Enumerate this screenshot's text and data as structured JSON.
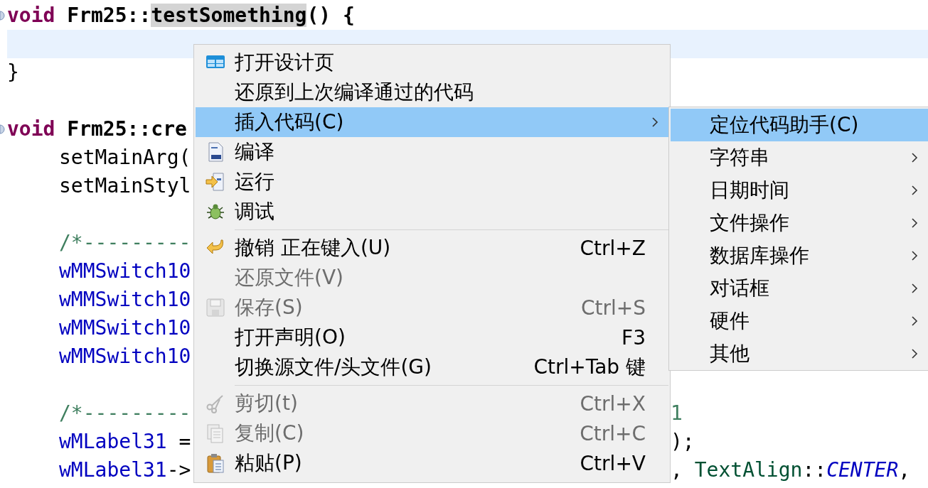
{
  "editor": {
    "lines": [
      {
        "kind": "code",
        "foldable": true,
        "current": false,
        "segments": [
          {
            "kind": "keyword",
            "text": "void",
            "highlighted": false
          },
          {
            "kind": "bold",
            "text": " Frm25::",
            "highlighted": false
          },
          {
            "kind": "bold",
            "text": "testSomething",
            "highlighted": true
          },
          {
            "kind": "bold",
            "text": "() {",
            "highlighted": false
          }
        ],
        "children": [
          {
            "kind": "blank",
            "current": true
          }
        ]
      },
      {
        "kind": "code",
        "foldable": false,
        "current": false,
        "segments": [
          {
            "kind": "plain",
            "text": "}",
            "highlighted": false
          }
        ]
      },
      {
        "kind": "blank",
        "current": false
      },
      {
        "kind": "code",
        "foldable": true,
        "current": false,
        "segments": [
          {
            "kind": "keyword",
            "text": "void",
            "highlighted": false
          },
          {
            "kind": "bold",
            "text": " Frm25::cre",
            "highlighted": false
          }
        ],
        "children": [
          {
            "kind": "code",
            "foldable": false,
            "current": false,
            "segments": [
              {
                "kind": "plain",
                "text": "setMainArg(",
                "highlighted": false
              }
            ]
          },
          {
            "kind": "code",
            "foldable": false,
            "current": false,
            "segments": [
              {
                "kind": "plain",
                "text": "setMainStyl",
                "highlighted": false
              }
            ]
          },
          {
            "kind": "blank",
            "current": false
          },
          {
            "kind": "code",
            "foldable": false,
            "current": false,
            "segments": [
              {
                "kind": "comment",
                "text": "/*---------",
                "highlighted": false
              }
            ]
          },
          {
            "kind": "code",
            "foldable": false,
            "current": false,
            "segments": [
              {
                "kind": "field",
                "text": "wMMSwitch10",
                "highlighted": false
              }
            ]
          },
          {
            "kind": "code",
            "foldable": false,
            "current": false,
            "segments": [
              {
                "kind": "field",
                "text": "wMMSwitch10",
                "highlighted": false
              }
            ]
          },
          {
            "kind": "code",
            "foldable": false,
            "current": false,
            "segments": [
              {
                "kind": "field",
                "text": "wMMSwitch10",
                "highlighted": false
              }
            ]
          },
          {
            "kind": "code",
            "foldable": false,
            "current": false,
            "segments": [
              {
                "kind": "field",
                "text": "wMMSwitch10",
                "highlighted": false
              }
            ]
          },
          {
            "kind": "blank",
            "current": false
          },
          {
            "kind": "code",
            "foldable": false,
            "current": false,
            "segments": [
              {
                "kind": "comment",
                "text": "/*---------",
                "highlighted": false
              }
            ],
            "after_menu": [
              {
                "kind": "comment",
                "text": "1",
                "highlighted": false
              }
            ]
          },
          {
            "kind": "code",
            "foldable": false,
            "current": false,
            "segments": [
              {
                "kind": "field",
                "text": "wMLabel31",
                "highlighted": false
              },
              {
                "kind": "plain",
                "text": " =",
                "highlighted": false
              }
            ],
            "after_menu": [
              {
                "kind": "plain",
                "text": ");",
                "highlighted": false
              }
            ]
          },
          {
            "kind": "code",
            "foldable": false,
            "current": false,
            "segments": [
              {
                "kind": "field",
                "text": "wMLabel31",
                "highlighted": false
              },
              {
                "kind": "plain",
                "text": "->",
                "highlighted": false
              }
            ],
            "after_menu": [
              {
                "kind": "plain",
                "text": ", ",
                "highlighted": false
              },
              {
                "kind": "type",
                "text": "TextAlign",
                "highlighted": false
              },
              {
                "kind": "plain",
                "text": "::",
                "highlighted": false
              },
              {
                "kind": "enum",
                "text": "CENTER",
                "highlighted": false
              },
              {
                "kind": "plain",
                "text": ",",
                "highlighted": false
              }
            ]
          }
        ]
      }
    ]
  },
  "menu": {
    "items": [
      {
        "kind": "item",
        "label": "打开设计页",
        "selected": false,
        "disabled": false,
        "has_submenu": false
      },
      {
        "kind": "item",
        "label": "还原到上次编译通过的代码",
        "selected": false,
        "disabled": false,
        "has_submenu": false
      },
      {
        "kind": "item",
        "label": "插入代码(C)",
        "selected": true,
        "disabled": false,
        "has_submenu": true
      },
      {
        "kind": "item",
        "label": "编译",
        "selected": false,
        "disabled": false,
        "has_submenu": false
      },
      {
        "kind": "item",
        "label": "运行",
        "selected": false,
        "disabled": false,
        "has_submenu": false
      },
      {
        "kind": "item",
        "label": "调试",
        "selected": false,
        "disabled": false,
        "has_submenu": false
      },
      {
        "kind": "separator"
      },
      {
        "kind": "item",
        "label": "撤销 正在键入(U)",
        "shortcut": "Ctrl+Z",
        "selected": false,
        "disabled": false,
        "has_submenu": false
      },
      {
        "kind": "item",
        "label": "还原文件(V)",
        "selected": false,
        "disabled": true,
        "has_submenu": false
      },
      {
        "kind": "item",
        "label": "保存(S)",
        "shortcut": "Ctrl+S",
        "selected": false,
        "disabled": true,
        "has_submenu": false
      },
      {
        "kind": "item",
        "label": "打开声明(O)",
        "shortcut": "F3",
        "selected": false,
        "disabled": false,
        "has_submenu": false
      },
      {
        "kind": "item",
        "label": "切换源文件/头文件(G)",
        "shortcut": "Ctrl+Tab 键",
        "selected": false,
        "disabled": false,
        "has_submenu": false
      },
      {
        "kind": "separator"
      },
      {
        "kind": "item",
        "label": "剪切(t)",
        "shortcut": "Ctrl+X",
        "selected": false,
        "disabled": true,
        "has_submenu": false
      },
      {
        "kind": "item",
        "label": "复制(C)",
        "shortcut": "Ctrl+C",
        "selected": false,
        "disabled": true,
        "has_submenu": false
      },
      {
        "kind": "item",
        "label": "粘贴(P)",
        "shortcut": "Ctrl+V",
        "selected": false,
        "disabled": false,
        "has_submenu": false
      }
    ]
  },
  "submenu": {
    "items": [
      {
        "label": "定位代码助手(C)",
        "selected": true,
        "has_submenu": false
      },
      {
        "label": "字符串",
        "selected": false,
        "has_submenu": true
      },
      {
        "label": "日期时间",
        "selected": false,
        "has_submenu": true
      },
      {
        "label": "文件操作",
        "selected": false,
        "has_submenu": true
      },
      {
        "label": "数据库操作",
        "selected": false,
        "has_submenu": true
      },
      {
        "label": "对话框",
        "selected": false,
        "has_submenu": true
      },
      {
        "label": "硬件",
        "selected": false,
        "has_submenu": true
      },
      {
        "label": "其他",
        "selected": false,
        "has_submenu": true
      }
    ]
  }
}
